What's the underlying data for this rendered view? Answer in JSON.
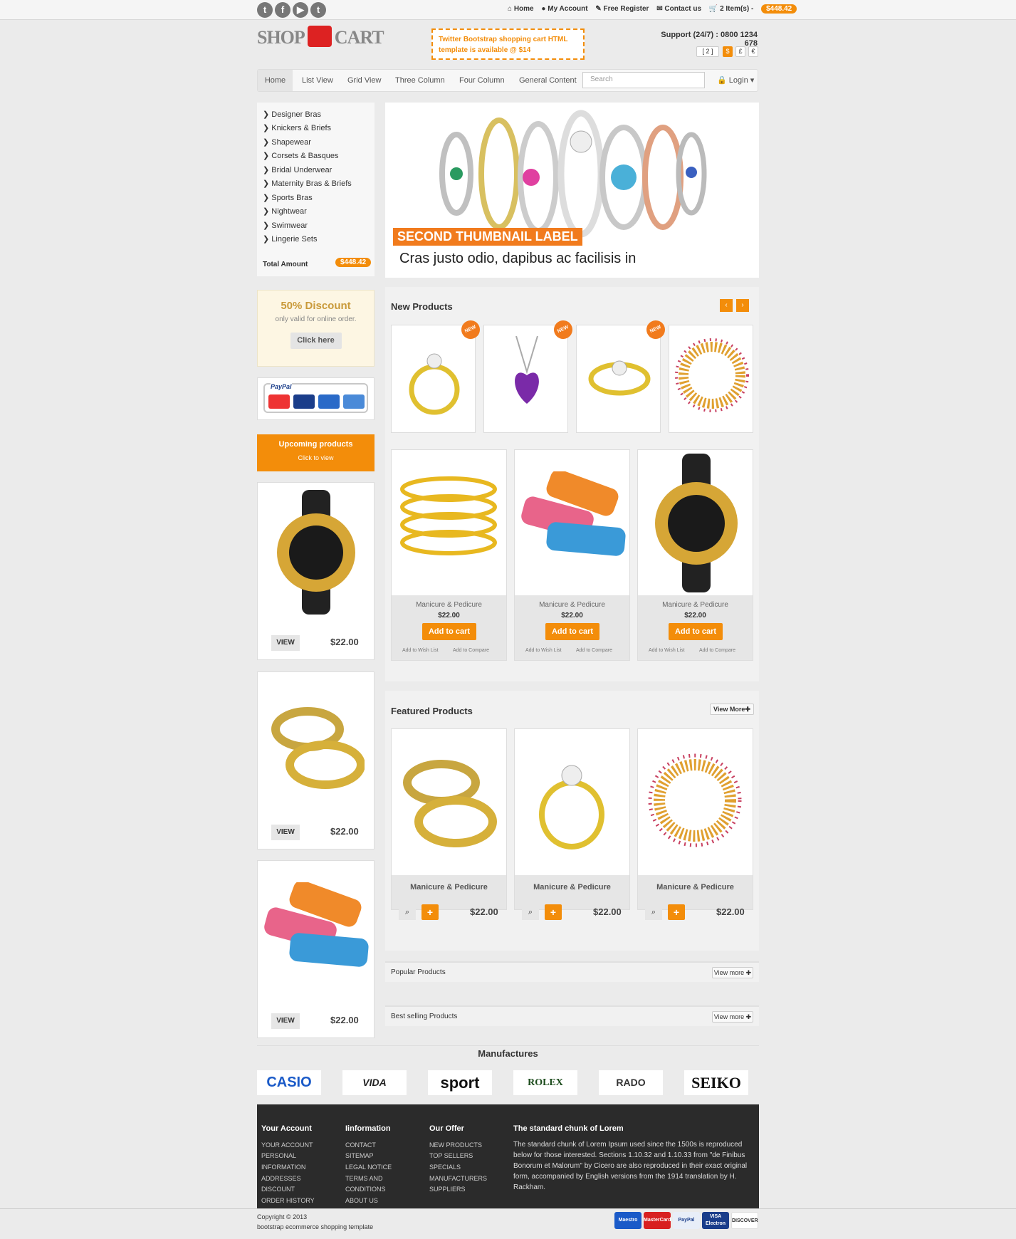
{
  "topbar": {
    "home": "Home",
    "account": "My Account",
    "register": "Free Register",
    "contact": "Contact us",
    "items": "2 Item(s) -",
    "total": "$448.42"
  },
  "social": [
    "t",
    "f",
    "▶",
    "t"
  ],
  "logo": {
    "left": "SHOP",
    "right": "CART"
  },
  "promo": {
    "line1": "Twitter Bootstrap shopping cart HTML",
    "line2": "template is available @ $14"
  },
  "support": "Support (24/7) : 0800 1234 678",
  "currency": {
    "cart": "[ 2 ]",
    "usd": "$",
    "gbp": "£",
    "eur": "€"
  },
  "nav": {
    "items": [
      "Home",
      "List View",
      "Grid View",
      "Three Column",
      "Four Column",
      "General Content"
    ],
    "search_placeholder": "Search",
    "login": "Login"
  },
  "categories": [
    "Designer Bras",
    "Knickers & Briefs",
    "Shapewear",
    "Corsets & Basques",
    "Bridal Underwear",
    "Maternity Bras & Briefs",
    "Sports Bras",
    "Nightwear",
    "Swimwear",
    "Lingerie Sets"
  ],
  "total": {
    "label": "Total Amount",
    "value": "$448.42"
  },
  "hero": {
    "label": "SECOND THUMBNAIL LABEL",
    "caption": "Cras justo odio, dapibus ac facilisis in"
  },
  "discount": {
    "title": "50% Discount",
    "subtitle": "only valid for online order.",
    "button": "Click here"
  },
  "paypal": "PayPal",
  "upcoming": {
    "title": "Upcoming products",
    "sub": "Click to view"
  },
  "side_products": [
    {
      "view": "VIEW",
      "price": "$22.00"
    },
    {
      "view": "VIEW",
      "price": "$22.00"
    },
    {
      "view": "VIEW",
      "price": "$22.00"
    }
  ],
  "new_products": {
    "title": "New Products",
    "tag": "NEW"
  },
  "grid_products": [
    {
      "name": "Manicure & Pedicure",
      "price": "$22.00",
      "cart": "Add to cart",
      "wish": "Add to Wish List",
      "compare": "Add to Compare"
    },
    {
      "name": "Manicure & Pedicure",
      "price": "$22.00",
      "cart": "Add to cart",
      "wish": "Add to Wish List",
      "compare": "Add to Compare"
    },
    {
      "name": "Manicure & Pedicure",
      "price": "$22.00",
      "cart": "Add to cart",
      "wish": "Add to Wish List",
      "compare": "Add to Compare"
    }
  ],
  "featured": {
    "title": "Featured Products",
    "more": "View More",
    "items": [
      {
        "name": "Manicure & Pedicure",
        "price": "$22.00"
      },
      {
        "name": "Manicure & Pedicure",
        "price": "$22.00"
      },
      {
        "name": "Manicure & Pedicure",
        "price": "$22.00"
      }
    ]
  },
  "popular": {
    "title": "Popular Products",
    "more": "View more"
  },
  "bestselling": {
    "title": "Best selling Products",
    "more": "View more"
  },
  "manufactures": {
    "title": "Manufactures",
    "brands": [
      "CASIO",
      "VIDA",
      "sport",
      "ROLEX",
      "RADO",
      "SEIKO"
    ]
  },
  "footer": {
    "account": {
      "title": "Your Account",
      "links": [
        "YOUR ACCOUNT",
        "PERSONAL",
        "INFORMATION",
        "ADDRESSES",
        "DISCOUNT",
        "ORDER HISTORY"
      ]
    },
    "info": {
      "title": "Iinformation",
      "links": [
        "CONTACT",
        "SITEMAP",
        "LEGAL NOTICE",
        "TERMS AND",
        "CONDITIONS",
        "ABOUT US"
      ]
    },
    "offer": {
      "title": "Our Offer",
      "links": [
        "NEW PRODUCTS",
        "TOP SELLERS",
        "SPECIALS",
        "MANUFACTURERS",
        "SUPPLIERS"
      ]
    },
    "lorem": {
      "title": "The standard chunk of Lorem",
      "text": "The standard chunk of Lorem Ipsum used since the 1500s is reproduced below for those interested. Sections 1.10.32 and 1.10.33 from \"de Finibus Bonorum et Malorum\" by Cicero are also reproduced in their exact original form, accompanied by English versions from the 1914 translation by H. Rackham."
    }
  },
  "copyright": {
    "line1": "Copyright © 2013",
    "line2": "bootstrap ecommerce shopping template"
  },
  "payments": [
    "Maestro",
    "MasterCard",
    "PayPal",
    "VISA Electron",
    "DISCOVER"
  ]
}
